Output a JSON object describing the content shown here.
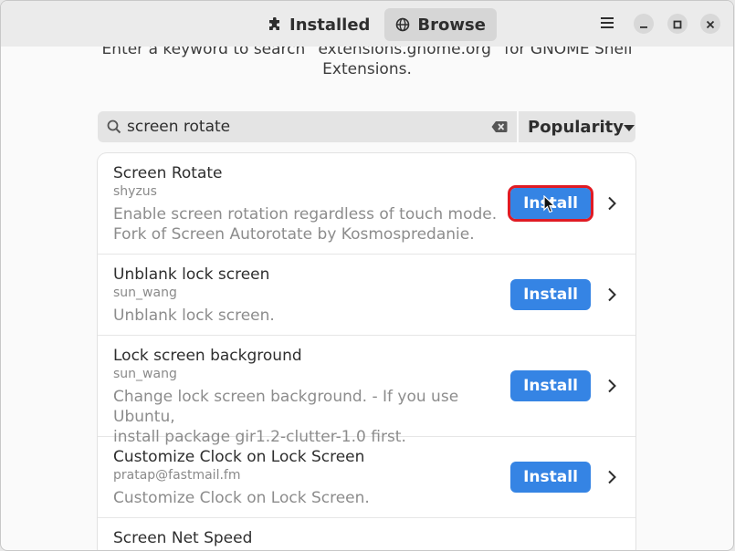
{
  "header": {
    "tabs": [
      {
        "label": "Installed",
        "icon": "puzzle-icon",
        "active": false
      },
      {
        "label": "Browse",
        "icon": "globe-icon",
        "active": true
      }
    ],
    "menu_icon": "hamburger-menu-icon",
    "window_controls": [
      "minimize-icon",
      "maximize-icon",
      "close-icon"
    ]
  },
  "hint": {
    "line1": "Enter a keyword to search “extensions.gnome.org” for GNOME Shell",
    "line2": "Extensions."
  },
  "search": {
    "value": "screen rotate",
    "icon": "search-icon",
    "clear_icon": "clear-icon"
  },
  "sort": {
    "selected": "Popularity"
  },
  "results": [
    {
      "name": "Screen Rotate",
      "author": "shyzus",
      "description_lines": [
        "Enable screen rotation regardless of touch mode.",
        "Fork of Screen Autorotate by Kosmospredanie."
      ],
      "action": "Install"
    },
    {
      "name": "Unblank lock screen",
      "author": "sun_wang",
      "description_lines": [
        "Unblank lock screen."
      ],
      "action": "Install"
    },
    {
      "name": "Lock screen background",
      "author": "sun_wang",
      "description_lines": [
        "Change lock screen background. - If you use Ubuntu,",
        "install package gir1.2-clutter-1.0 first."
      ],
      "action": "Install"
    },
    {
      "name": "Customize Clock on Lock Screen",
      "author": "pratap@fastmail.fm",
      "description_lines": [
        "Customize Clock on Lock Screen."
      ],
      "action": "Install"
    },
    {
      "name": "Screen Net Speed",
      "author": "",
      "description_lines": [],
      "action": ""
    }
  ],
  "colors": {
    "accent": "#3584e4",
    "highlight": "#e01b24"
  }
}
